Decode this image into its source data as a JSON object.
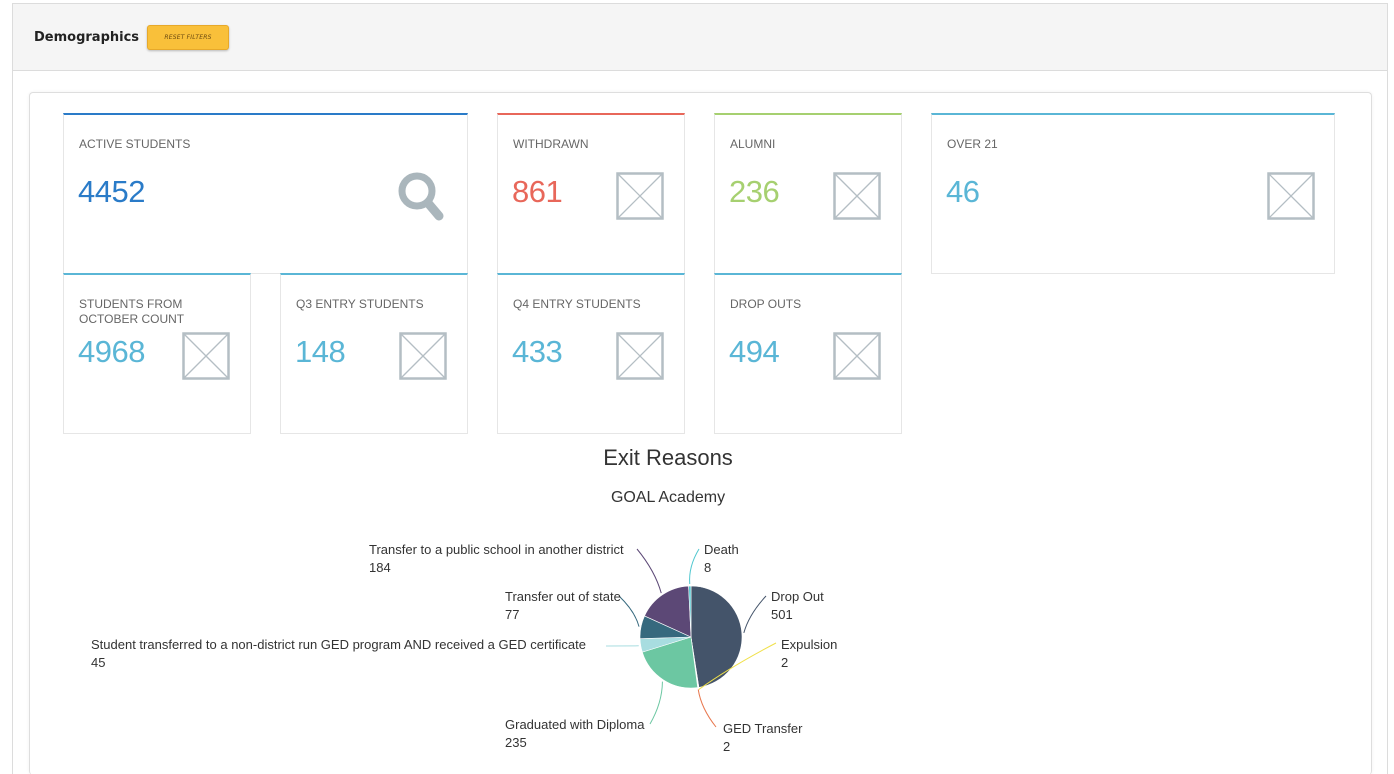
{
  "header": {
    "title": "Demographics",
    "reset_label": "RESET FILTERS"
  },
  "tiles": [
    {
      "label": "ACTIVE STUDENTS",
      "value": "4452",
      "color": "#2a7bc8",
      "icon": "search-icon"
    },
    {
      "label": "WITHDRAWN",
      "value": "861",
      "color": "#e8675a",
      "icon": "image-placeholder-icon"
    },
    {
      "label": "ALUMNI",
      "value": "236",
      "color": "#a6d070",
      "icon": "image-placeholder-icon"
    },
    {
      "label": "OVER 21",
      "value": "46",
      "color": "#5ab6d6",
      "icon": "image-placeholder-icon"
    },
    {
      "label": "STUDENTS FROM OCTOBER COUNT",
      "value": "4968",
      "color": "#5ab6d6",
      "icon": "image-placeholder-icon"
    },
    {
      "label": "Q3 ENTRY STUDENTS",
      "value": "148",
      "color": "#5ab6d6",
      "icon": "image-placeholder-icon"
    },
    {
      "label": "Q4 ENTRY STUDENTS",
      "value": "433",
      "color": "#5ab6d6",
      "icon": "image-placeholder-icon"
    },
    {
      "label": "DROP OUTS",
      "value": "494",
      "color": "#5ab6d6",
      "icon": "image-placeholder-icon"
    }
  ],
  "chart_data": {
    "type": "pie",
    "title": "Exit Reasons",
    "subtitle": "GOAL Academy",
    "slices": [
      {
        "name": "Drop Out",
        "value": 501,
        "color": "#44546a"
      },
      {
        "name": "Expulsion",
        "value": 2,
        "color": "#f0e04a"
      },
      {
        "name": "GED Transfer",
        "value": 2,
        "color": "#e8774e"
      },
      {
        "name": "Graduated with Diploma",
        "value": 235,
        "color": "#6cc7a2"
      },
      {
        "name": "Student transferred to a non-district run GED program AND received a GED certificate",
        "value": 45,
        "color": "#a8dde0"
      },
      {
        "name": "Transfer out of state",
        "value": 77,
        "color": "#36697e"
      },
      {
        "name": "Transfer to a public school in another district",
        "value": 184,
        "color": "#5c4876"
      },
      {
        "name": "Death",
        "value": 8,
        "color": "#4fc7cf"
      }
    ],
    "extra_slices_colors": [
      "#b0e060",
      "#e8d040"
    ]
  }
}
